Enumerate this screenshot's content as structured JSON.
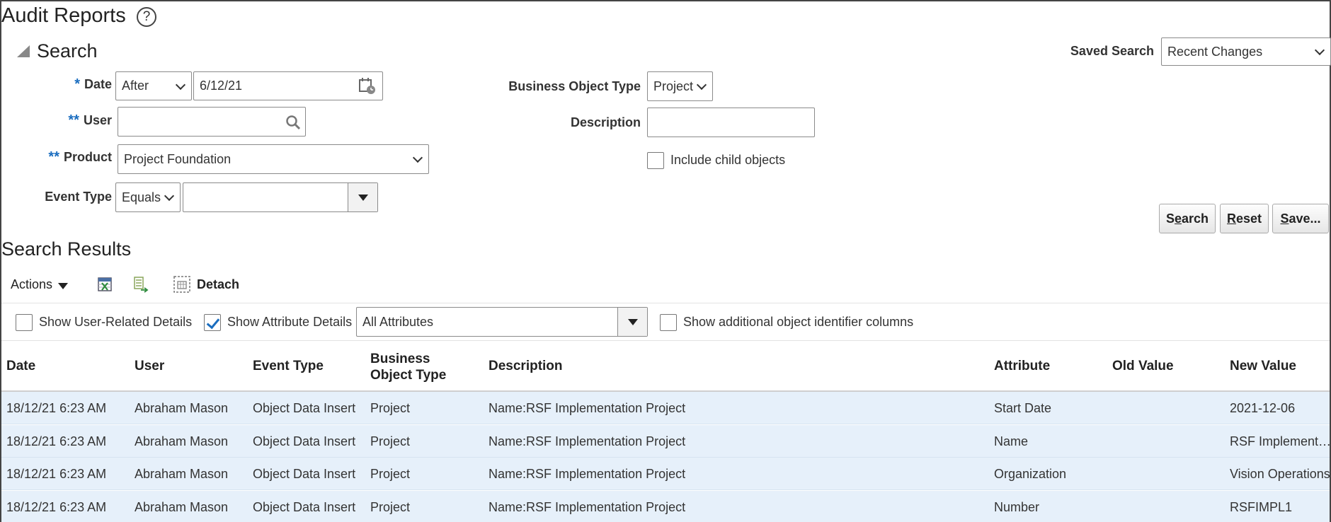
{
  "page": {
    "title": "Audit Reports"
  },
  "search": {
    "section_title": "Search",
    "saved_search_label": "Saved Search",
    "saved_search_value": "Recent Changes",
    "date_required": "*",
    "date_label": "Date",
    "date_operator": "After",
    "date_value": "6/12/21",
    "user_required": "**",
    "user_label": "User",
    "user_value": "",
    "product_required": "**",
    "product_label": "Product",
    "product_value": "Project Foundation",
    "event_type_label": "Event Type",
    "event_type_operator": "Equals",
    "event_type_value": "",
    "bo_type_label": "Business Object Type",
    "bo_type_value": "Project",
    "description_label": "Description",
    "description_value": "",
    "include_child_label": "Include child objects",
    "buttons": {
      "search_pre": "S",
      "search_u": "e",
      "search_post": "arch",
      "reset_u": "R",
      "reset_post": "eset",
      "save_u": "S",
      "save_post": "ave..."
    }
  },
  "results": {
    "title": "Search Results",
    "actions_label": "Actions",
    "detach_label": "Detach",
    "show_user_label": "Show User-Related Details",
    "show_attr_label": "Show Attribute Details",
    "attr_filter_value": "All Attributes",
    "show_additional_label": "Show additional object identifier columns",
    "columns": [
      "Date",
      "User",
      "Event Type",
      "Business",
      "Object Type",
      "Description",
      "Attribute",
      "Old Value",
      "New Value"
    ],
    "rows": [
      [
        "18/12/21 6:23 AM",
        "Abraham Mason",
        "Object Data Insert",
        "Project",
        "Name:RSF Implementation Project",
        "Start Date",
        "",
        "2021-12-06"
      ],
      [
        "18/12/21 6:23 AM",
        "Abraham Mason",
        "Object Data Insert",
        "Project",
        "Name:RSF Implementation Project",
        "Name",
        "",
        "RSF Implement…"
      ],
      [
        "18/12/21 6:23 AM",
        "Abraham Mason",
        "Object Data Insert",
        "Project",
        "Name:RSF Implementation Project",
        "Organization",
        "",
        "Vision Operations"
      ],
      [
        "18/12/21 6:23 AM",
        "Abraham Mason",
        "Object Data Insert",
        "Project",
        "Name:RSF Implementation Project",
        "Number",
        "",
        "RSFIMPL1"
      ]
    ]
  }
}
